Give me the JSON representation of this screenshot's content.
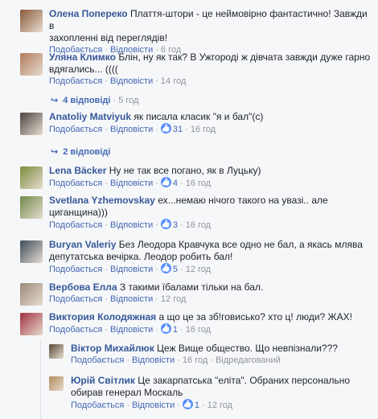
{
  "ui": {
    "like": "Подобається",
    "reply": "Відповісти",
    "edited": "Відредагований",
    "dot": "·"
  },
  "comments": [
    {
      "author": "Олена Поперeко",
      "text_lines": [
        "Плаття-штори - це неймовірно фантастично! Завжди в",
        "захопленні від переглядів!"
      ],
      "time": "6 год",
      "avatar": "#8a5a3a"
    },
    {
      "author": "Уляна Климко",
      "text_lines": [
        "Блін, ну як так? В Ужгороді ж дівчата завжди дуже гарно",
        "вдягались... (((("
      ],
      "time": "14 год",
      "avatar": "#b07a5a",
      "replies": {
        "label": "4 відповіді",
        "time": "5 год"
      }
    },
    {
      "author": "Anatoliy Matviyuk",
      "text_lines": [
        "як писала класик \"я и бал\"(с)"
      ],
      "likes": "31",
      "time": "16 год",
      "avatar": "#4a4440",
      "replies": {
        "label": "2 відповіді",
        "time": ""
      }
    },
    {
      "author": "Lena Bäcker",
      "text_lines": [
        "Ну не так все погано, як в Луцьку)"
      ],
      "likes": "4",
      "time": "16 год",
      "avatar": "#7a8c3a"
    },
    {
      "author": "Svetlana Yzhemovskay",
      "text_lines": [
        "ех...немаю нічого такого на увазі.. але",
        "циганщина)))"
      ],
      "likes": "3",
      "time": "16 год",
      "avatar": "#6f8a4a"
    },
    {
      "author": "Buryan Valeriy",
      "text_lines": [
        "Без Леодора Кравчука все одно не бал, а якась млява",
        "депутатська вечірка. Леодор робить бал!"
      ],
      "likes": "5",
      "time": "12 год",
      "avatar": "#3c4c5c"
    },
    {
      "author": "Вербова Елла",
      "text_lines": [
        "З такими їбалами тільки на бал."
      ],
      "time": "12 год",
      "avatar": "#9a8a7a"
    },
    {
      "author": "Виктория Колодяжная",
      "text_lines": [
        "а що це за зб!говисько? хто ц! люди? ЖАХ!"
      ],
      "likes": "1",
      "time": "16 год",
      "avatar": "#a03040"
    }
  ],
  "nested": [
    {
      "author": "Віктор Михайлюк",
      "text_lines": [
        "Цеж Вище общество. Що невпізнали???"
      ],
      "time": "16 год",
      "edited": true,
      "avatar": "#5a4a3a"
    },
    {
      "author": "Юрій Світлик",
      "text_lines": [
        "Це закарпатська \"еліта\". Обраних персонально",
        "обирав генерал Москаль"
      ],
      "likes": "1",
      "time": "12 год",
      "avatar": "#b08a5a"
    }
  ]
}
